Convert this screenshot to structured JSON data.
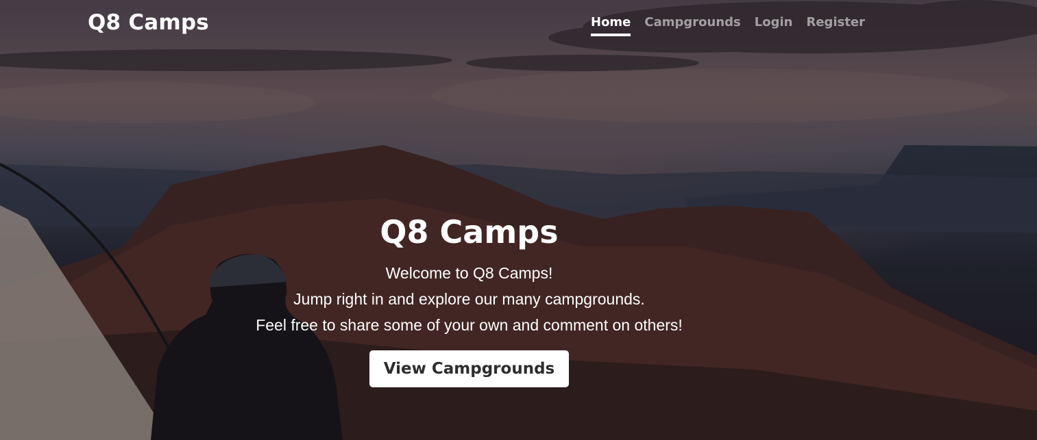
{
  "navbar": {
    "brand": "Q8 Camps",
    "links": [
      {
        "label": "Home",
        "active": true
      },
      {
        "label": "Campgrounds",
        "active": false
      },
      {
        "label": "Login",
        "active": false
      },
      {
        "label": "Register",
        "active": false
      }
    ]
  },
  "hero": {
    "title": "Q8 Camps",
    "lines": [
      "Welcome to Q8 Camps!",
      "Jump right in and explore our many campgrounds.",
      "Feel free to share some of your own and comment on others!"
    ],
    "button_label": "View Campgrounds"
  }
}
